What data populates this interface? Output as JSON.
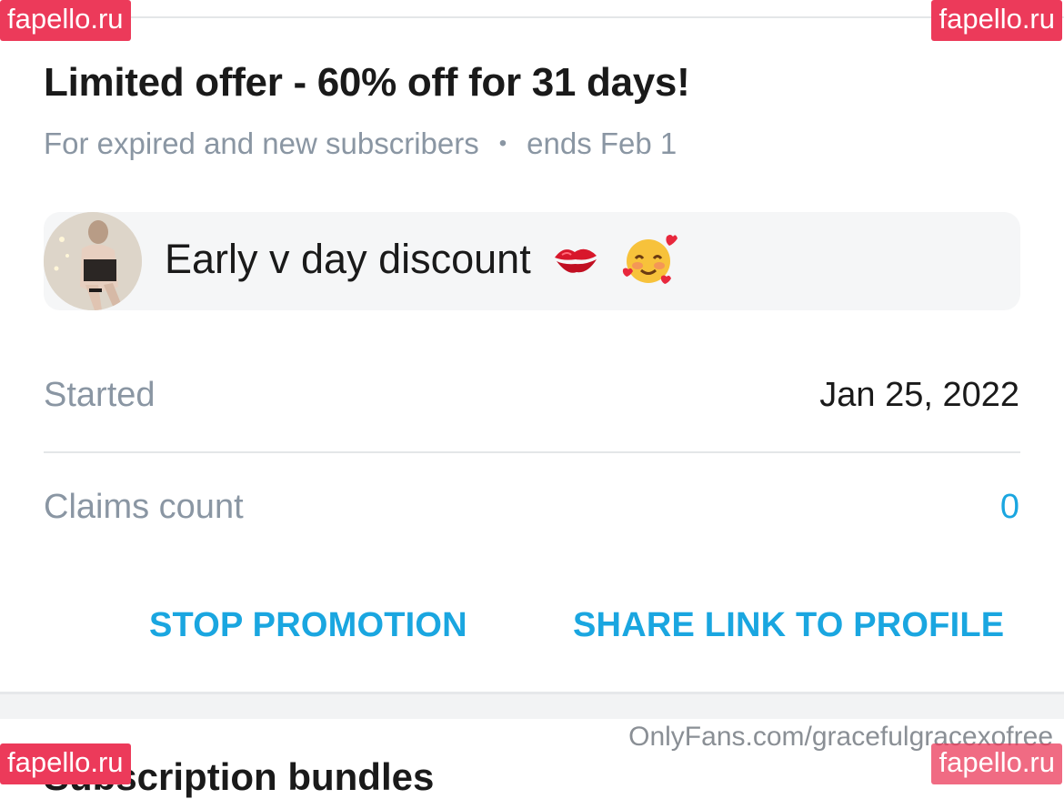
{
  "promotion": {
    "title": "Limited offer - 60% off for 31 days!",
    "audience": "For expired and new subscribers",
    "separator": "•",
    "ends": "ends Feb 1",
    "message": "Early v day discount",
    "message_emojis": [
      "kiss-mark",
      "smiling-face-with-hearts"
    ]
  },
  "details": {
    "started_label": "Started",
    "started_value": "Jan 25, 2022",
    "claims_label": "Claims count",
    "claims_value": "0"
  },
  "actions": {
    "stop": "STOP PROMOTION",
    "share": "SHARE LINK TO PROFILE"
  },
  "next_section": {
    "title": "Subscription bundles"
  },
  "watermarks": {
    "site": "fapello.ru",
    "credit": "OnlyFans.com/gracefulgracexofree"
  },
  "colors": {
    "accent": "#1aa6e0",
    "muted": "#8a96a3",
    "watermark": "#ec3a5a"
  }
}
